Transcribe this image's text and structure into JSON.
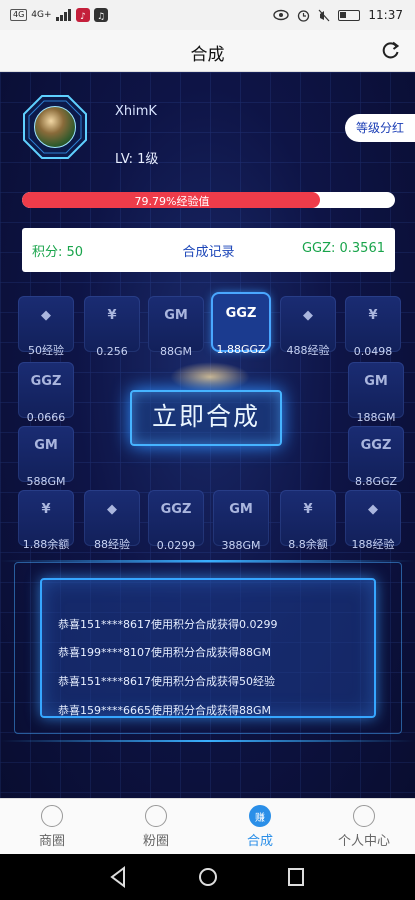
{
  "status_bar": {
    "network_badge": "4G",
    "signal_text": "4G+",
    "time": "11:37"
  },
  "header": {
    "title": "合成",
    "refresh_icon": "refresh-icon"
  },
  "profile": {
    "username": "XhimK",
    "level": "LV: 1级",
    "level_button": "等级分红",
    "exp_progress": 0.7979,
    "exp_text": "79.79%经验值"
  },
  "info_bar": {
    "points": "积分: 50",
    "records_link": "合成记录",
    "ggz": "GGZ: 0.3561"
  },
  "tiles": [
    {
      "icon": "diamond-icon",
      "glyph": "◆",
      "label": "50经验"
    },
    {
      "icon": "money-bag-icon",
      "glyph": "¥",
      "label": "0.256"
    },
    {
      "icon": "gm-icon",
      "glyph": "GM",
      "label": "88GM"
    },
    {
      "icon": "ggz-icon",
      "glyph": "GGZ",
      "label": "1.88GGZ",
      "active": true
    },
    {
      "icon": "diamond-icon",
      "glyph": "◆",
      "label": "488经验"
    },
    {
      "icon": "money-bag-icon",
      "glyph": "¥",
      "label": "0.0498"
    },
    {
      "icon": "ggz-icon",
      "glyph": "GGZ",
      "label": "0.0666"
    },
    {
      "icon": "gm-icon",
      "glyph": "GM",
      "label": "188GM"
    },
    {
      "icon": "gm-icon",
      "glyph": "GM",
      "label": "588GM"
    },
    {
      "icon": "ggz-icon",
      "glyph": "GGZ",
      "label": "8.8GGZ"
    },
    {
      "icon": "money-bag-icon",
      "glyph": "¥",
      "label": "1.88余额"
    },
    {
      "icon": "diamond-icon",
      "glyph": "◆",
      "label": "88经验"
    },
    {
      "icon": "ggz-icon",
      "glyph": "GGZ",
      "label": "0.0299"
    },
    {
      "icon": "gm-icon",
      "glyph": "GM",
      "label": "388GM"
    },
    {
      "icon": "money-bag-icon",
      "glyph": "¥",
      "label": "8.8余额"
    },
    {
      "icon": "diamond-icon",
      "glyph": "◆",
      "label": "188经验"
    }
  ],
  "combine_button": "立即合成",
  "log": [
    "恭喜151****8617使用积分合成获得0.0299",
    "恭喜199****8107使用积分合成获得88GM",
    "恭喜151****8617使用积分合成获得50经验",
    "恭喜159****6665使用积分合成获得88GM"
  ],
  "bottom_nav": [
    {
      "label": "商圈",
      "icon": "shop-icon"
    },
    {
      "label": "粉圈",
      "icon": "fans-icon"
    },
    {
      "label": "合成",
      "icon": "combine-icon",
      "active": true,
      "badge": "赚"
    },
    {
      "label": "个人中心",
      "icon": "user-icon"
    }
  ],
  "colors": {
    "bg": "#0b1035",
    "accent_blue": "#2b8fe8",
    "exp_red": "#ee3c4a",
    "green_text": "#19a44b"
  }
}
